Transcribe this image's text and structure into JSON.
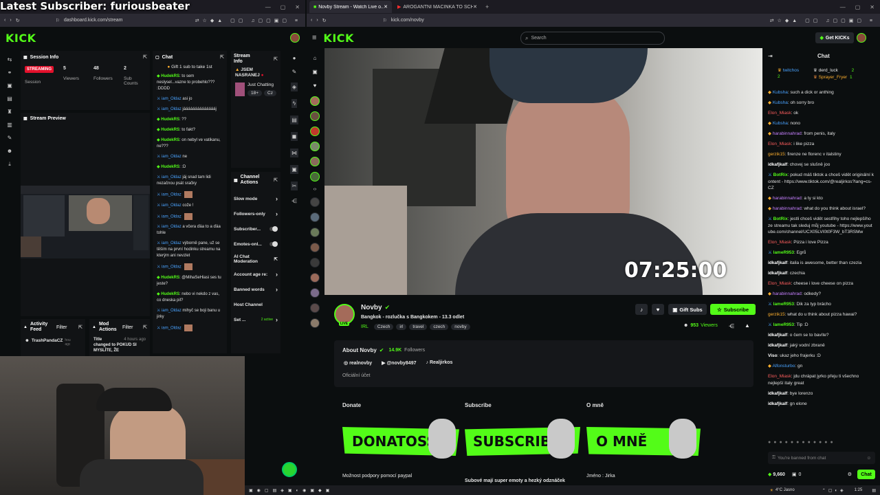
{
  "overlay_title": "Latest Subscriber: furiousbeater",
  "left_window": {
    "tabs": [],
    "url": "dashboard.kick.com/stream",
    "logo": "KICK",
    "session_info": {
      "title": "Session Info",
      "streaming_label": "STREAMING",
      "session_label": "Session",
      "stats": [
        {
          "value": "5",
          "label": "Viewers"
        },
        {
          "value": "48",
          "label": "Followers"
        },
        {
          "value": "2",
          "label": "Sub Counts"
        }
      ]
    },
    "stream_preview_title": "Stream Preview",
    "chat_panel": {
      "title": "Chat",
      "pinned": "Gift 1 sub to take 1st",
      "messages": [
        {
          "user": "HudekRS",
          "text": ": to sem neslysel...vazne to probehlo??? :DDDD",
          "color": "g"
        },
        {
          "user": "iam_Oldaz",
          "text": " asi jo",
          "color": "b"
        },
        {
          "user": "iam_Oldaz",
          "text": " jááááááááááááááj",
          "color": "b"
        },
        {
          "user": "HudekRS",
          "text": ": ??",
          "color": "g"
        },
        {
          "user": "HudekRS",
          "text": ": to fakt?",
          "color": "g"
        },
        {
          "user": "HudekRS",
          "text": ": on nebyl ve vatikanu, ne???",
          "color": "g"
        },
        {
          "user": "iam_Oldaz",
          "text": " ne",
          "color": "b"
        },
        {
          "user": "HudekRS",
          "text": ": :D",
          "color": "g"
        },
        {
          "user": "iam_Oldaz",
          "text": " jáj snad tam lidi nezačnou psát sračky",
          "color": "b"
        },
        {
          "user": "iam_Oldaz",
          "text": "",
          "color": "b"
        },
        {
          "user": "iam_Oldaz",
          "text": " cože !",
          "color": "b"
        },
        {
          "user": "iam_Oldaz",
          "text": "",
          "color": "b"
        },
        {
          "user": "iam_Oldaz",
          "text": " a včera ďáa to a ďáa tohle",
          "color": "b"
        },
        {
          "user": "iam_Oldaz",
          "text": " výborně pane, už se těším na první hodinku streamu na kterým ani nevzlet",
          "color": "b"
        },
        {
          "user": "iam_Oldaz",
          "text": "",
          "color": "b"
        },
        {
          "user": "HudekRS",
          "text": ": @MihaSeHiasi ses tu jeste?",
          "color": "g"
        },
        {
          "user": "HudekRS",
          "text": ": nebo vi nekdo z vas, co dneska pil?",
          "color": "g"
        },
        {
          "user": "iam_Oldaz",
          "text": " mihyč se boji banu u jirky",
          "color": "b"
        },
        {
          "user": "iam_Oldaz",
          "text": "",
          "color": "b"
        }
      ]
    },
    "stream_info": {
      "title": "Stream Info",
      "stream_title": "JSEM NASRANEJ",
      "category": "Just Chatting",
      "age": "18+",
      "lang": "Cz"
    },
    "channel_actions": {
      "title": "Channel Actions",
      "items": [
        "Slow mode",
        "Followers-only",
        "Subscriber...",
        "Emotes-onl...",
        "AI Chat Moderation",
        "Account age re:",
        "Banned words",
        "Host Channel",
        "Set ..."
      ],
      "active_label": "2 active"
    },
    "activity_feed": {
      "title": "Activity Feed",
      "filter": "Filter",
      "user": "TrashPandaCZ",
      "user_suffix": "hou agc"
    },
    "mod_actions": {
      "title": "Mod Actions",
      "filter": "Filter",
      "entry_title": "Title",
      "entry_time": "4 hours ago",
      "entry_text": "changed to POKUD SI MYSLÍTE, ŽE"
    }
  },
  "right_window": {
    "tabs": [
      {
        "label": "Novby Stream - Watch Live o...",
        "active": true
      },
      {
        "label": "AROGANTNÍ MACINKA TO SCHYTAL",
        "active": false
      }
    ],
    "url": "kick.com/novby",
    "logo": "KICK",
    "search_placeholder": "Search",
    "get_kicks": "Get KICKs",
    "video_timer": "07:25:00",
    "channel": {
      "name": "Novby",
      "live_badge": "LIVE",
      "stream_title": "Bangkok - rozlučka s Bangkokem - 13.3 odlet",
      "category": "IRL",
      "tags": [
        "Czech",
        "irl",
        "travel",
        "czech",
        "novby"
      ],
      "viewers": "953",
      "viewers_label": "Viewers",
      "gift_subs": "Gift Subs",
      "subscribe": "Subscribe"
    },
    "about": {
      "title": "About Novby",
      "followers": "14.9K",
      "followers_label": "Followers",
      "socials": [
        "realnovby",
        "@novby8497",
        "Realjirkos"
      ],
      "official": "Oficiální účet"
    },
    "panels": [
      {
        "heading": "Donate",
        "banner": "DONATOSS",
        "caption": "Možnost podpory pomocí paypal"
      },
      {
        "heading": "Subscribe",
        "banner": "SUBSCRIBE",
        "caption": "Subové mají super emoty a hezký odznáček"
      },
      {
        "heading": "O mně",
        "banner": "O MNĚ",
        "caption": "Jméno : Jirka"
      }
    ],
    "chat": {
      "title": "Chat",
      "top_gifters": [
        {
          "name": "twitchos",
          "count": "2"
        },
        {
          "name": "derd_luck",
          "count": "2"
        },
        {
          "name": "Sprayer_Fryer",
          "count": "1"
        }
      ],
      "messages": [
        {
          "user": "Kubsha",
          "text": ": such a dick or anthing",
          "color": "b"
        },
        {
          "user": "Kubsha",
          "text": ": oh sorry bro",
          "color": "b"
        },
        {
          "user": "Elon_Miask",
          "text": ": ok",
          "color": "r"
        },
        {
          "user": "Kubsha",
          "text": ": nono",
          "color": "b"
        },
        {
          "user": "harabinnahrad",
          "text": ": from penis, italy",
          "color": "p"
        },
        {
          "user": "Elon_Miask",
          "text": ": i like pizza",
          "color": "r"
        },
        {
          "user": "gerzik15",
          "text": ": firenze ne florenc v italstiny",
          "color": "o"
        },
        {
          "user": "idkafjkalf",
          "text": ": chovej se slušně joo",
          "color": "w"
        },
        {
          "user": "BotRix",
          "text": ": pokud máš tiktok a chceš vidět originální kontent - https://www.tiktok.com/@realjirkos?lang=cs-CZ",
          "color": "g"
        },
        {
          "user": "harabinnahrad",
          "text": ": a ty si kto",
          "color": "p"
        },
        {
          "user": "harabinnahrad",
          "text": ": what do you think about israel?",
          "color": "p"
        },
        {
          "user": "BotRix",
          "text": ": jestli chceš vidět sestřihy toho nejlepšího ze streamu tak sleduj můj youtube - https://www.youtube.com/channel/UCX05LVI0t0F3W_bT3RSMw",
          "color": "g"
        },
        {
          "user": "Elon_Miask",
          "text": ": Pizza i love Pizza",
          "color": "r"
        },
        {
          "user": "lameR953",
          "text": ": Egrů",
          "color": "g"
        },
        {
          "user": "idkafjkalf",
          "text": ": italia is awesome, better than czezia",
          "color": "w"
        },
        {
          "user": "idkafjkalf",
          "text": ": czechia",
          "color": "w"
        },
        {
          "user": "Elon_Miask",
          "text": ": cheese i love cheese on pizza",
          "color": "r"
        },
        {
          "user": "harabinnahrad",
          "text": ": odkedy?",
          "color": "p"
        },
        {
          "user": "lameR953",
          "text": ": Dik za typ brácho",
          "color": "g"
        },
        {
          "user": "gerzik15",
          "text": ": what do u think about pizza hawai?",
          "color": "o"
        },
        {
          "user": "lameR953",
          "text": ": Tip :D",
          "color": "g"
        },
        {
          "user": "idkafjkalf",
          "text": ": o čem se to bavíte?",
          "color": "w"
        },
        {
          "user": "idkafjkalf",
          "text": ": jaký vodní zbraně",
          "color": "w"
        },
        {
          "user": "Viso",
          "text": ": ukaz jeho frajerku :D",
          "color": "w"
        },
        {
          "user": "Alfonsturbo",
          "text": ": gn",
          "color": "b"
        },
        {
          "user": "Elon_Miask",
          "text": ": jdu chrápat jyrko přeju ti všechno nejlepší italy great",
          "color": "r"
        },
        {
          "user": "idkafjkalf",
          "text": ": bye lorenzo",
          "color": "w"
        },
        {
          "user": "idkafjkalf",
          "text": ": gn elone",
          "color": "w"
        }
      ],
      "banned_text": "You're banned from chat",
      "points": "9,660",
      "zero": "0",
      "chat_button": "Chat"
    }
  },
  "taskbar": {
    "weather": "4°C  Jasno",
    "time": "1:25"
  },
  "colors": {
    "kick_green": "#53fc18",
    "bg": "#0b0e0f",
    "panel": "#191b1f"
  }
}
